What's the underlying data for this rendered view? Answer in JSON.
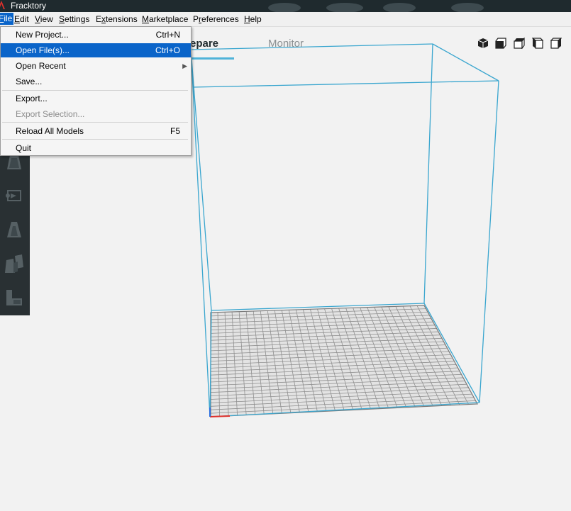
{
  "window": {
    "title": "Fracktory"
  },
  "menubar": {
    "items": [
      {
        "label": "File",
        "mnemonic": "F"
      },
      {
        "label": "Edit",
        "mnemonic": "E"
      },
      {
        "label": "View",
        "mnemonic": "V"
      },
      {
        "label": "Settings",
        "mnemonic": "S"
      },
      {
        "label": "Extensions",
        "mnemonic": "x"
      },
      {
        "label": "Marketplace",
        "mnemonic": "M"
      },
      {
        "label": "Preferences",
        "mnemonic": "r"
      },
      {
        "label": "Help",
        "mnemonic": "H"
      }
    ]
  },
  "file_menu": {
    "items": [
      {
        "label": "New Project...",
        "shortcut": "Ctrl+N"
      },
      {
        "label": "Open File(s)...",
        "shortcut": "Ctrl+O",
        "state": "highlighted"
      },
      {
        "label": "Open Recent",
        "shortcut": "",
        "submenu": true
      },
      {
        "label": "Save...",
        "shortcut": ""
      },
      {
        "label": "Export...",
        "shortcut": ""
      },
      {
        "label": "Export Selection...",
        "shortcut": "",
        "state": "disabled"
      },
      {
        "label": "Reload All Models",
        "shortcut": "F5"
      },
      {
        "label": "Quit",
        "shortcut": ""
      }
    ]
  },
  "header": {
    "tabs": [
      {
        "label": "Prepare",
        "visible_text": "epare",
        "active": true
      },
      {
        "label": "Monitor",
        "visible_text": "Monitor",
        "active": false
      }
    ]
  },
  "view_buttons": [
    "3d-view-icon",
    "front-view-icon",
    "top-view-icon",
    "left-view-icon",
    "right-view-icon"
  ],
  "left_toolbar": [
    "scale-tool-icon",
    "rotate-tool-icon",
    "mirror-tool-icon",
    "per-model-settings-icon",
    "support-blocker-icon"
  ],
  "colors": {
    "accent": "#4fb3d9",
    "titlebar": "#1f2a2e",
    "toolbar": "#293033",
    "menu_highlight": "#0a64c9",
    "build_volume_line": "#3aa6cf",
    "plate_grid": "#8f8f8f"
  }
}
